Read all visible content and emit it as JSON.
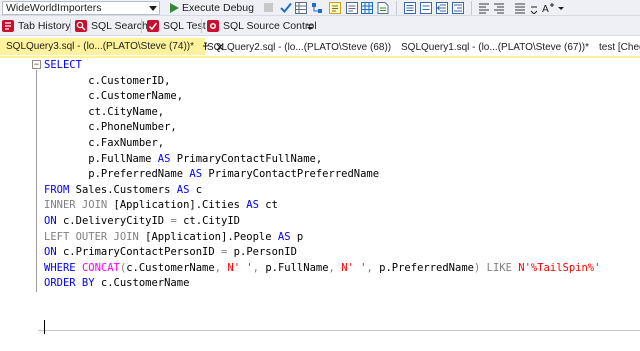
{
  "toolbar1": {
    "database": "WideWorldImporters",
    "execute_label": "Execute",
    "debug_label": "Debug"
  },
  "toolbar2": {
    "tab_history_label": "Tab History",
    "sql_search_label": "SQL Search",
    "sql_test_label": "SQL Test",
    "sql_source_control_label": "SQL Source Control"
  },
  "tabs": [
    {
      "label": "SQLQuery3.sql - (lo...(PLATO\\Steve (74))*",
      "active": true
    },
    {
      "label": "SQLQuery2.sql - (lo...(PLATO\\Steve (68))",
      "active": false
    },
    {
      "label": "SQLQuery1.sql - (lo...(PLATO\\Steve (67))*",
      "active": false
    },
    {
      "label": "test [Check",
      "active": false
    }
  ],
  "editor": {
    "lines": [
      [
        {
          "t": "SELECT",
          "c": "kw"
        }
      ],
      [
        {
          "t": "       c.CustomerID,",
          "c": "id"
        }
      ],
      [
        {
          "t": "       c.CustomerName,",
          "c": "id"
        }
      ],
      [
        {
          "t": "       ct.CityName,",
          "c": "id"
        }
      ],
      [
        {
          "t": "       c.PhoneNumber,",
          "c": "id"
        }
      ],
      [
        {
          "t": "       c.FaxNumber,",
          "c": "id"
        }
      ],
      [
        {
          "t": "       p.FullName ",
          "c": "id"
        },
        {
          "t": "AS",
          "c": "kw"
        },
        {
          "t": " PrimaryContactFullName,",
          "c": "id"
        }
      ],
      [
        {
          "t": "       p.PreferredName ",
          "c": "id"
        },
        {
          "t": "AS",
          "c": "kw"
        },
        {
          "t": " PrimaryContactPreferredName",
          "c": "id"
        }
      ],
      [
        {
          "t": "FROM",
          "c": "kw"
        },
        {
          "t": " Sales.Customers ",
          "c": "id"
        },
        {
          "t": "AS",
          "c": "kw"
        },
        {
          "t": " c",
          "c": "id"
        }
      ],
      [
        {
          "t": "INNER JOIN",
          "c": "gr"
        },
        {
          "t": " [Application].Cities ",
          "c": "id"
        },
        {
          "t": "AS",
          "c": "kw"
        },
        {
          "t": " ct",
          "c": "id"
        }
      ],
      [
        {
          "t": "ON",
          "c": "kw"
        },
        {
          "t": " c.DeliveryCityID ",
          "c": "id"
        },
        {
          "t": "=",
          "c": "gr"
        },
        {
          "t": " ct.CityID",
          "c": "id"
        }
      ],
      [
        {
          "t": "LEFT OUTER JOIN",
          "c": "gr"
        },
        {
          "t": " [Application].People ",
          "c": "id"
        },
        {
          "t": "AS",
          "c": "kw"
        },
        {
          "t": " p",
          "c": "id"
        }
      ],
      [
        {
          "t": "ON",
          "c": "kw"
        },
        {
          "t": " c.PrimaryContactPersonID ",
          "c": "id"
        },
        {
          "t": "=",
          "c": "gr"
        },
        {
          "t": " p.PersonID",
          "c": "id"
        }
      ],
      [
        {
          "t": "WHERE",
          "c": "kw"
        },
        {
          "t": " ",
          "c": "id"
        },
        {
          "t": "CONCAT",
          "c": "fn"
        },
        {
          "t": "(",
          "c": "gr"
        },
        {
          "t": "c.CustomerName",
          "c": "id"
        },
        {
          "t": ",",
          "c": "gr"
        },
        {
          "t": " ",
          "c": "id"
        },
        {
          "t": "N' '",
          "c": "str"
        },
        {
          "t": ",",
          "c": "gr"
        },
        {
          "t": " p.FullName",
          "c": "id"
        },
        {
          "t": ",",
          "c": "gr"
        },
        {
          "t": " ",
          "c": "id"
        },
        {
          "t": "N' '",
          "c": "str"
        },
        {
          "t": ",",
          "c": "gr"
        },
        {
          "t": " p.PreferredName",
          "c": "id"
        },
        {
          "t": ")",
          "c": "gr"
        },
        {
          "t": " ",
          "c": "id"
        },
        {
          "t": "LIKE",
          "c": "gr"
        },
        {
          "t": " ",
          "c": "id"
        },
        {
          "t": "N'%TailSpin%'",
          "c": "str"
        }
      ],
      [
        {
          "t": "ORDER BY",
          "c": "kw"
        },
        {
          "t": " c.CustomerName",
          "c": "id"
        }
      ]
    ]
  },
  "colors": {
    "keyword": "#0000ff",
    "operator": "#808080",
    "function": "#ff00ff",
    "string": "#ff0000",
    "active_tab": "#fff29d"
  }
}
